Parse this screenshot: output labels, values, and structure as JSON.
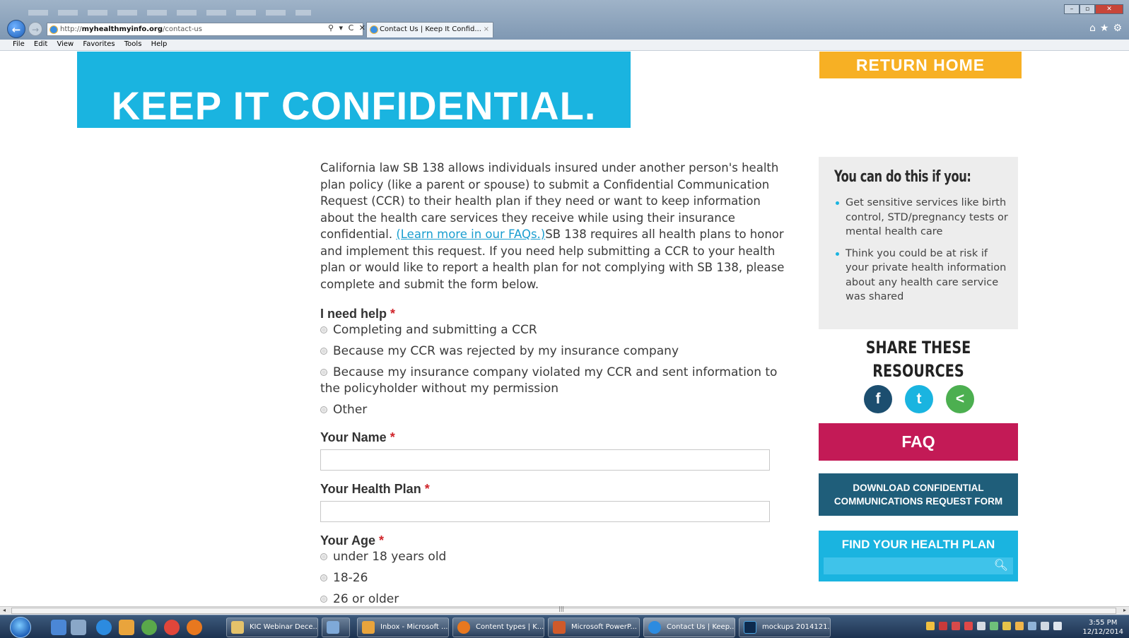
{
  "browser": {
    "address": {
      "prefix": "http://",
      "domain": "myhealthmyinfo.org",
      "path": "/contact-us"
    },
    "address_tools": "⚲ ▾ C ✕",
    "tab_title": "Contact Us | Keep It Confid...",
    "tab_close": "×",
    "menu": [
      "File",
      "Edit",
      "View",
      "Favorites",
      "Tools",
      "Help"
    ],
    "window_buttons": {
      "minimize": "–",
      "maximize": "▫",
      "close": "✕"
    },
    "toolbar_icons": "⌂★⚙"
  },
  "header": {
    "hero_title": "KEEP IT CONFIDENTIAL.",
    "return_home": "RETURN HOME"
  },
  "intro": {
    "before_link": "California law SB 138 allows individuals insured under another person's health plan policy (like a parent or spouse) to submit a Confidential Communication Request (CCR) to their health plan if they need or want to keep information about the health care services they receive while using their insurance confidential. ",
    "link": "(Learn more in our FAQs.)",
    "after_link": "SB 138 requires all health plans to honor and implement this request. If you need help submitting a CCR to your health plan or would like to report a health plan for not complying with SB 138, please complete and submit the form below."
  },
  "form": {
    "required_mark": "*",
    "help_label": "I need help",
    "help_options": [
      "Completing and submitting a CCR",
      "Because my CCR was rejected by my insurance company",
      "Because my insurance company violated my CCR and sent information to the policyholder without my permission",
      "Other"
    ],
    "name_label": "Your Name",
    "name_value": "",
    "plan_label": "Your Health Plan",
    "plan_value": "",
    "age_label": "Your Age",
    "age_options": [
      "under 18 years old",
      "18-26",
      "26 or older"
    ]
  },
  "sidebar": {
    "cando_title": "You can do this if you:",
    "cando_items": [
      "Get sensitive services like birth control, STD/pregnancy tests or mental health care",
      "Think you could be at risk if your private health information about any health care service was shared"
    ],
    "share_line1": "SHARE THESE",
    "share_line2": "RESOURCES",
    "social_glyphs": {
      "facebook": "f",
      "twitter": "t",
      "share": "<"
    },
    "faq": "FAQ",
    "download_line1": "DOWNLOAD CONFIDENTIAL",
    "download_line2": "COMMUNICATIONS REQUEST FORM",
    "find_plan": "FIND YOUR HEALTH PLAN",
    "search_value": "",
    "search_glyph": "🔍︎",
    "colors": {
      "cyan": "#1ab4e0",
      "yellow": "#f7b024",
      "magenta": "#c31a56",
      "teal": "#1f5e7a",
      "green": "#4caf50",
      "navy": "#1c4e6f"
    }
  },
  "scrollbar": {
    "grip": "|||",
    "left_arrow": "◂",
    "right_arrow": "▸"
  },
  "taskbar": {
    "buttons": [
      "KIC Webinar Dece...",
      "",
      "Inbox - Microsoft ...",
      "Content types | K...",
      "Microsoft PowerP...",
      "Contact Us | Keep...",
      "mockups 2014121..."
    ],
    "time": "3:55 PM",
    "date": "12/12/2014"
  }
}
